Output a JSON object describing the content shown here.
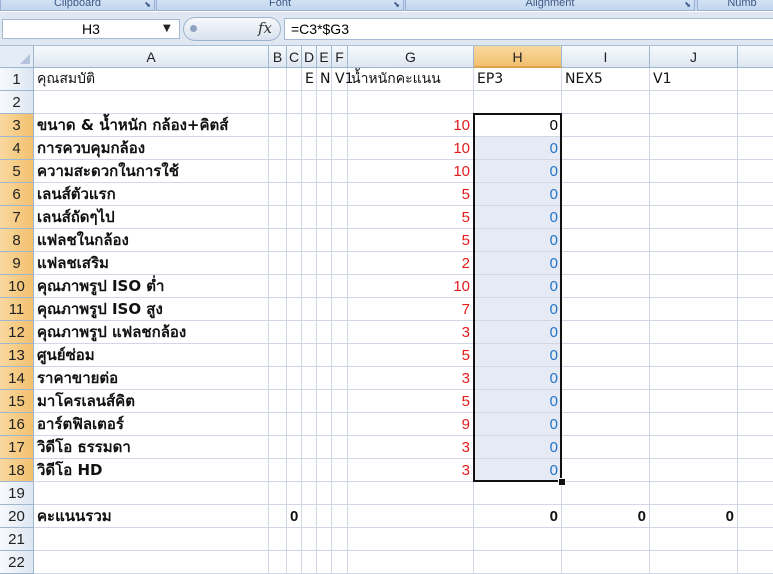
{
  "ribbon": {
    "groups": [
      "Clipboard",
      "Font",
      "Alignment",
      "Numb"
    ]
  },
  "formula_bar": {
    "name_box": "H3",
    "fx_icon": "function-icon",
    "formula": "=C3*$G3"
  },
  "columns": [
    "A",
    "B",
    "C",
    "D",
    "E",
    "F",
    "G",
    "H",
    "I",
    "J"
  ],
  "active_column": "H",
  "rows": [
    {
      "n": "1",
      "A": "คุณสมบัติ",
      "E": "E",
      "D": "",
      "C": "",
      "E2": "NI",
      "F": "V1",
      "G": "น้ำหนักคะแนน",
      "H": "EP3",
      "I": "NEX5",
      "J": "V1"
    },
    {
      "n": "2"
    },
    {
      "n": "3",
      "A": "ขนาด & น้ำหนัก กล้อง+คิตส์",
      "G": "10",
      "H": "0"
    },
    {
      "n": "4",
      "A": "การควบคุมกล้อง",
      "G": "10",
      "H": "0"
    },
    {
      "n": "5",
      "A": "ความสะดวกในการใช้",
      "G": "10",
      "H": "0"
    },
    {
      "n": "6",
      "A": "เลนส์ตัวแรก",
      "G": "5",
      "H": "0"
    },
    {
      "n": "7",
      "A": "เลนส์ถัดๆไป",
      "G": "5",
      "H": "0"
    },
    {
      "n": "8",
      "A": "แฟลชในกล้อง",
      "G": "5",
      "H": "0"
    },
    {
      "n": "9",
      "A": "แฟลชเสริม",
      "G": "2",
      "H": "0"
    },
    {
      "n": "10",
      "A": "คุณภาพรูป ISO ต่ำ",
      "G": "10",
      "H": "0"
    },
    {
      "n": "11",
      "A": "คุณภาพรูป ISO สูง",
      "G": "7",
      "H": "0"
    },
    {
      "n": "12",
      "A": "คุณภาพรูป แฟลชกล้อง",
      "G": "3",
      "H": "0"
    },
    {
      "n": "13",
      "A": "ศูนย์ซ่อม",
      "G": "5",
      "H": "0"
    },
    {
      "n": "14",
      "A": "ราคาขายต่อ",
      "G": "3",
      "H": "0"
    },
    {
      "n": "15",
      "A": "มาโครเลนส์คิต",
      "G": "5",
      "H": "0"
    },
    {
      "n": "16",
      "A": "อาร์ตฟิลเตอร์",
      "G": "9",
      "H": "0"
    },
    {
      "n": "17",
      "A": "วิดีโอ ธรรมดา",
      "G": "3",
      "H": "0"
    },
    {
      "n": "18",
      "A": "วิดีโอ HD",
      "G": "3",
      "H": "0"
    },
    {
      "n": "19"
    },
    {
      "n": "20",
      "A": "คะแนนรวม",
      "C": "0",
      "H": "0",
      "I": "0",
      "J": "0"
    },
    {
      "n": "21"
    },
    {
      "n": "22"
    }
  ],
  "selection": {
    "cell": "H3",
    "range": "H3:H18"
  },
  "colors": {
    "weight": "#e31b1b",
    "score": "#2274c6",
    "active_header": "#f2c06e"
  }
}
